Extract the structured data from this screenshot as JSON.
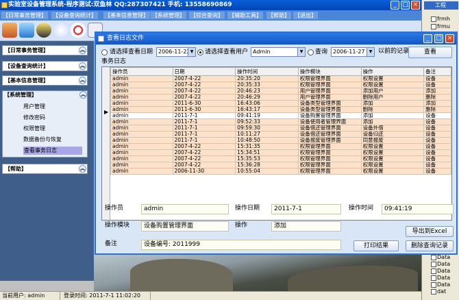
{
  "app": {
    "title": "实验室设备管理系统-程序测试:双鱼林  QQ:287307421 手机: 13558690869",
    "menu": [
      "【日常事务管理】",
      "【设备查询统计】",
      "【基本信息管理】",
      "【系统管理】",
      "【综合查询】",
      "【辅助工具】",
      "【帮助】",
      "【退出】"
    ]
  },
  "nav": {
    "sections": [
      "【日常事务管理】",
      "【设备查询统计】",
      "【基本信息管理】",
      "【系统管理】",
      "【帮助】"
    ],
    "system_items": [
      "用户管理",
      "修改密码",
      "权限管理",
      "数据备份与恢复",
      "查看事务日志"
    ]
  },
  "tree": {
    "caption": "工程",
    "items": [
      "frmh",
      "frmu",
      "Data",
      "Data",
      "Data",
      "Data",
      "Data",
      "dat",
      "dat",
      "dat"
    ]
  },
  "dialog": {
    "title": "查看日志文件",
    "filter": {
      "by_date_label": "请选择查看日期",
      "date_value": "2006-11-22",
      "by_user_label": "请选择查看用户",
      "user_value": "Admin",
      "query_label": "查询",
      "before_date": "2006-11-27",
      "before_suffix": "以前的记录",
      "view_button": "查看"
    },
    "group_title": "事务日志",
    "columns": [
      "操作员",
      "日期",
      "操作时间",
      "操作模块",
      "操作",
      "备注"
    ],
    "rows": [
      [
        "admin",
        "2007-4-22",
        "20:35:20",
        "权限管理界面",
        "权限设置",
        "设备"
      ],
      [
        "admin",
        "2007-4-22",
        "20:35:33",
        "权限管理界面",
        "权限设置",
        "设备"
      ],
      [
        "admin",
        "2007-4-22",
        "20:46:23",
        "用户管理界面",
        "添加用户",
        "添加"
      ],
      [
        "admin",
        "2007-4-22",
        "20:46:29",
        "用户管理界面",
        "删除用户",
        "删除"
      ],
      [
        "admin",
        "2011-6-30",
        "16:43:06",
        "设备类型管理界面",
        "添加",
        "添加"
      ],
      [
        "admin",
        "2011-6-30",
        "16:43:17",
        "设备类型管理界面",
        "删除",
        "删除"
      ],
      [
        "admin",
        "2011-7-1",
        "09:41:19",
        "设备购置管理界面",
        "添加",
        "设备"
      ],
      [
        "admin",
        "2011-7-1",
        "09:52:33",
        "设备使用者管理界面",
        "添加",
        "设备"
      ],
      [
        "admin",
        "2011-7-1",
        "09:59:30",
        "设备借还管理界面",
        "设备外借",
        "设备"
      ],
      [
        "admin",
        "2011-7-1",
        "10:11:27",
        "设备借还管理界面",
        "设备归还",
        "设备"
      ],
      [
        "admin",
        "2011-7-1",
        "10:48:50",
        "设备报废管理界面",
        "同意报废",
        "设备"
      ],
      [
        "admin",
        "2007-4-22",
        "15:31:35",
        "权限管理界面",
        "权限设置",
        "设备"
      ],
      [
        "admin",
        "2007-4-22",
        "15:34:51",
        "权限管理界面",
        "权限设置",
        "设备"
      ],
      [
        "admin",
        "2007-4-22",
        "15:35:53",
        "权限管理界面",
        "权限设置",
        "设备"
      ],
      [
        "admin",
        "2007-4-22",
        "15:36:28",
        "权限管理界面",
        "权限设置",
        "设备"
      ],
      [
        "admin",
        "2006-11-30",
        "10:55:04",
        "权限管理界面",
        "权限设置",
        "设备"
      ]
    ],
    "detail": {
      "operator_label": "操作员",
      "operator_value": "admin",
      "date_label": "操作日期",
      "date_value": "2011-7-1",
      "time_label": "操作时间",
      "time_value": "09:41:19",
      "module_label": "操作模块",
      "module_value": "设备购置管理界面",
      "action_label": "操作",
      "action_value": "添加",
      "remark_label": "备注",
      "remark_value": "设备编号: 2011999"
    },
    "buttons": {
      "export": "导出到Excel",
      "print": "打印结果",
      "delete": "删除查询记录"
    }
  },
  "status": {
    "user": "当前用户: admin",
    "login_time": "登录时间: 2011-7-1 11:02:20"
  },
  "colors": {
    "title_blue": "#0a5fd8",
    "grid_row": "#fde1c9",
    "dialog_bg": "#d9e6f5"
  }
}
